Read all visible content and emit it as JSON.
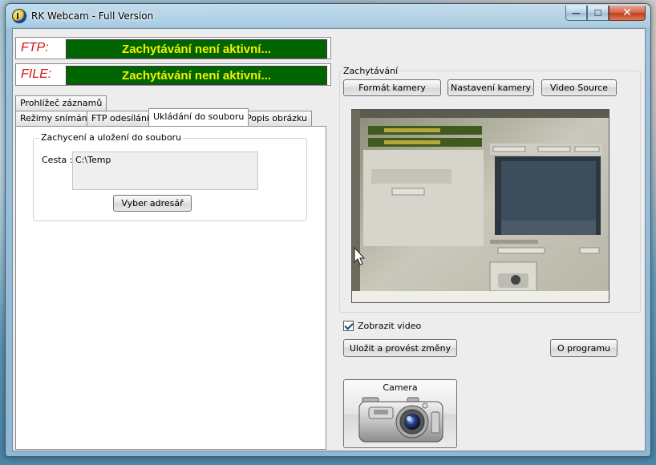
{
  "window": {
    "title": "RK Webcam - Full Version",
    "min_glyph": "—",
    "max_glyph": "☐",
    "close_glyph": "✕"
  },
  "status": {
    "ftp_label": "FTP:",
    "ftp_text": "Zachytávání není aktivní...",
    "file_label": "FILE:",
    "file_text": "Zachytávání není aktivní..."
  },
  "tabs": {
    "row_back": [
      "Prohlížeč záznamů"
    ],
    "row_front": [
      "Režimy snímání",
      "FTP odesílání",
      "Ukládání do souboru",
      "Popis obrázku"
    ],
    "active": "Ukládání do souboru"
  },
  "save_panel": {
    "group_title": "Zachycení a uložení do souboru",
    "path_label": "Cesta :",
    "path_value": "C:\\Temp",
    "choose_button": "Vyber adresář"
  },
  "capture": {
    "group_title": "Zachytávání",
    "format_button": "Formát kamery",
    "settings_button": "Nastavení kamery",
    "source_button": "Video Source",
    "show_video_label": "Zobrazit video",
    "show_video_checked": true,
    "save_button": "Uložit a provést změny",
    "about_button": "O programu",
    "camera_button": "Camera"
  },
  "colors": {
    "status_bg": "#006400",
    "status_text": "#f2f200",
    "status_label": "#e01010"
  },
  "icons": {
    "app": "rk-webcam-app-icon",
    "camera": "digital-camera-icon"
  }
}
